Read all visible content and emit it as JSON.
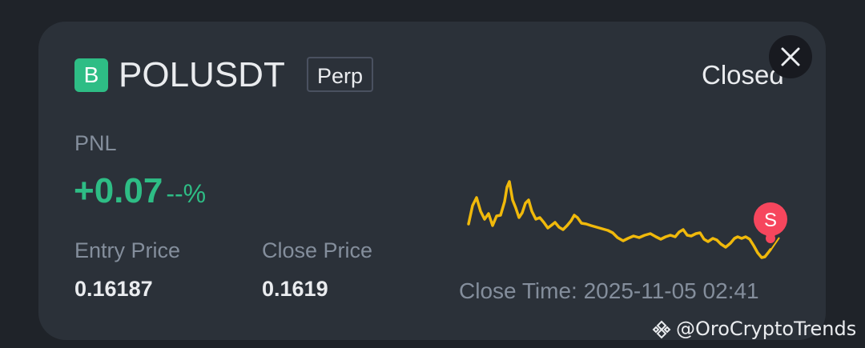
{
  "position": {
    "badge_letter": "B",
    "symbol": "POLUSDT",
    "contract_type": "Perp",
    "status": "Closed"
  },
  "pnl": {
    "label": "PNL",
    "value": "+0.07",
    "percent": "--%"
  },
  "prices": {
    "entry_label": "Entry Price",
    "entry_value": "0.16187",
    "close_label": "Close Price",
    "close_value": "0.1619"
  },
  "chart": {
    "marker_label": "S",
    "close_time": "Close Time: 2025-11-05 02:41"
  },
  "watermark": {
    "text": "@OroCryptoTrends"
  },
  "colors": {
    "positive": "#2ebd85",
    "line": "#f0b90b",
    "sell_marker": "#f6465d",
    "card_bg": "#2b3139"
  },
  "icons": {
    "close": "close-icon",
    "brand": "binance-icon"
  }
}
